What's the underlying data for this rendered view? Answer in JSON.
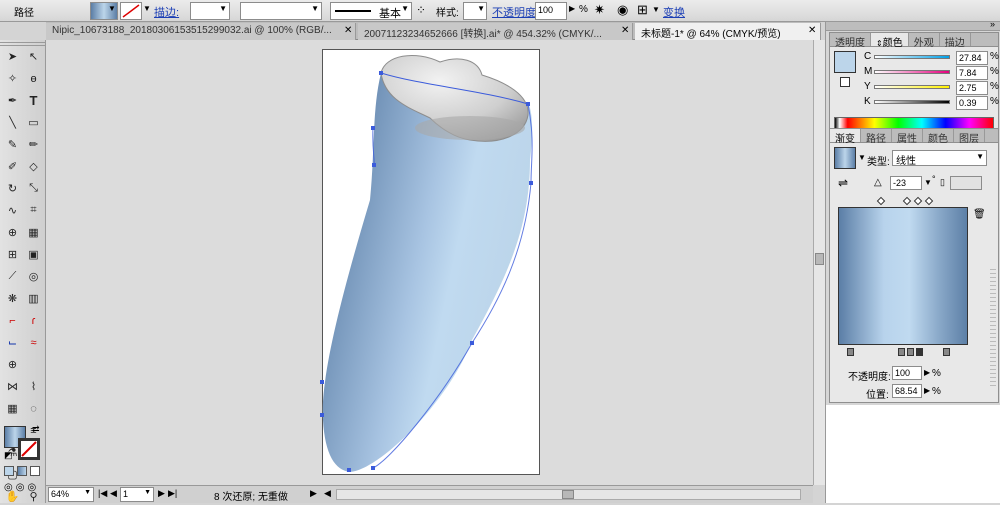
{
  "control_bar": {
    "object_label": "路径",
    "stroke_label": "描边:",
    "brush_label": "基本",
    "style_label": "样式:",
    "opacity_label": "不透明度:",
    "opacity_value": "100",
    "opacity_unit": "%",
    "transform_label": "变换"
  },
  "doc_tabs": [
    {
      "label": "Nipic_10673188_20180306153515299032.ai @ 100% (RGB/..."
    },
    {
      "label": "20071123234652666 [转换].ai* @ 454.32% (CMYK/..."
    },
    {
      "label": "未标题-1* @ 64% (CMYK/预览)"
    }
  ],
  "color_panel": {
    "tabs": [
      "透明度",
      "颜色",
      "外观",
      "描边"
    ],
    "active_tab": "颜色",
    "channels": [
      {
        "name": "C",
        "value": "27.84",
        "color": "#00a0e8"
      },
      {
        "name": "M",
        "value": "7.84",
        "color": "#e4007f"
      },
      {
        "name": "Y",
        "value": "2.75",
        "color": "#fff100"
      },
      {
        "name": "K",
        "value": "0.39",
        "color": "#000000"
      }
    ],
    "swatch_color": "#bcd5ea"
  },
  "gradient_panel": {
    "tabs": [
      "渐变",
      "路径",
      "属性",
      "颜色",
      "图层"
    ],
    "active_tab": "渐变",
    "type_label": "类型:",
    "type_value": "线性",
    "angle_value": "-23",
    "angle_unit": "°",
    "opacity_label": "不透明度:",
    "opacity_value": "100",
    "opacity_unit": "%",
    "position_label": "位置:",
    "position_value": "68.54",
    "position_unit": "%",
    "colors": [
      "#5b7ea6",
      "#b8d3ec",
      "#c0daf0",
      "#8aa9c9",
      "#5d80a7"
    ]
  },
  "status_bar": {
    "zoom": "64%",
    "page": "1",
    "undo_text": "8 次还原; 无重做"
  }
}
